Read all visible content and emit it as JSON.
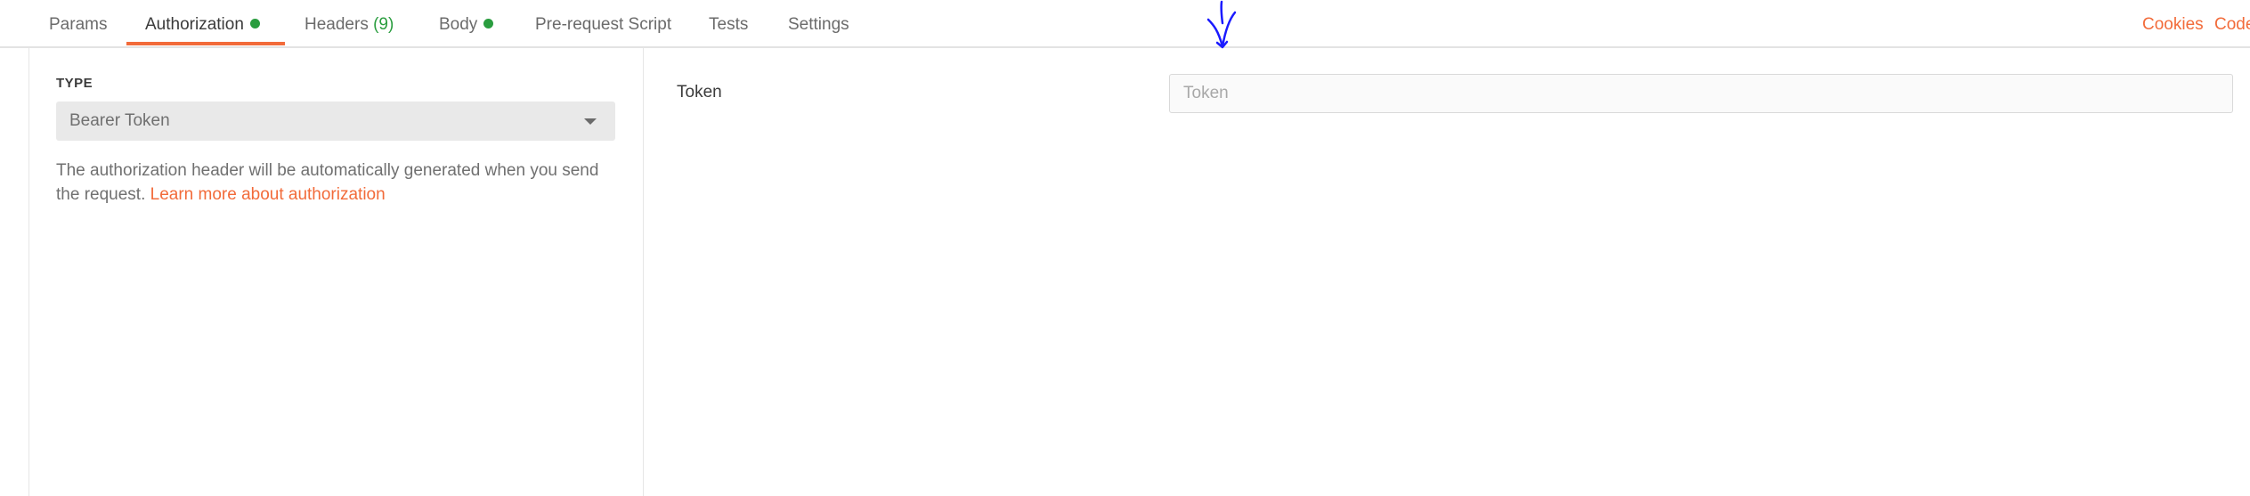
{
  "tabs": {
    "params": "Params",
    "authorization": "Authorization",
    "headers": "Headers",
    "headers_count": "(9)",
    "body": "Body",
    "prerequest": "Pre-request Script",
    "tests": "Tests",
    "settings": "Settings"
  },
  "links": {
    "cookies": "Cookies",
    "code": "Code"
  },
  "auth": {
    "type_label": "TYPE",
    "type_value": "Bearer Token",
    "help_text": "The authorization header will be automatically generated when you send the request. ",
    "help_link": "Learn more about authorization"
  },
  "token": {
    "label": "Token",
    "placeholder": "Token",
    "value": ""
  },
  "colors": {
    "accent": "#f26b3a",
    "status_green": "#2a9d3f",
    "annotation_blue": "#1a1aff"
  },
  "icons": [
    "status-dot-icon",
    "caret-down-icon",
    "annotation-arrow-icon"
  ]
}
